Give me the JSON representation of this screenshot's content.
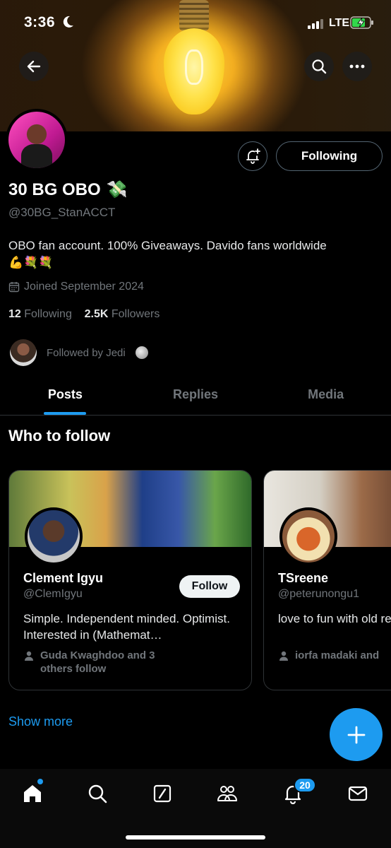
{
  "status_bar": {
    "time": "3:36",
    "network": "LTE"
  },
  "profile": {
    "name": "30 BG OBO",
    "name_emoji": "💸",
    "handle": "@30BG_StanACCT",
    "bio": "OBO fan account. 100% Giveaways. Davido fans worldwide",
    "bio_emojis": "💪💐💐",
    "joined": "Joined September 2024",
    "following_count": "12",
    "following_label": "Following",
    "followers_count": "2.5K",
    "followers_label": "Followers",
    "followed_by": "Followed by Jedi",
    "following_button": "Following"
  },
  "tabs": [
    {
      "label": "Posts",
      "active": true
    },
    {
      "label": "Replies",
      "active": false
    },
    {
      "label": "Media",
      "active": false
    }
  ],
  "who_to_follow": {
    "title": "Who to follow",
    "cards": [
      {
        "name": "Clement Igyu",
        "handle": "@ClemIgyu",
        "follow_label": "Follow",
        "bio": "Simple. Independent minded. Optimist. Interested in (Mathemat…",
        "followed_by": "Guda Kwaghdoo and 3 others follow"
      },
      {
        "name": "TSreene",
        "handle": "@peterunongu1",
        "bio": "love to fun with old reach me is below",
        "followed_by": "iorfa madaki and"
      }
    ],
    "show_more": "Show more"
  },
  "bottom_nav": {
    "items": [
      "home-icon",
      "search-icon",
      "grok-icon",
      "communities-icon",
      "notifications-icon",
      "messages-icon"
    ],
    "notifications_badge": "20"
  },
  "colors": {
    "accent": "#1d9bf0",
    "background": "#000000",
    "secondary_text": "#71767b"
  }
}
